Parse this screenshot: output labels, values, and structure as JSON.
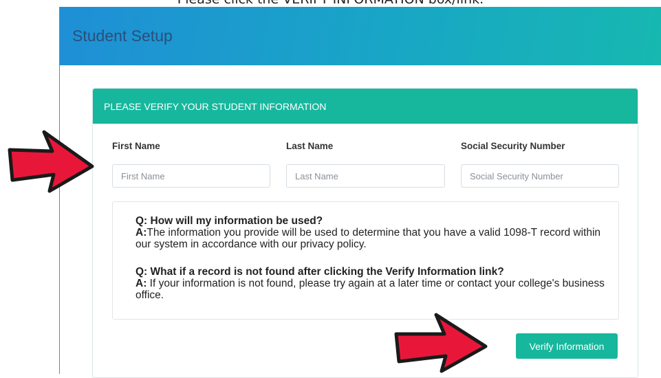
{
  "caption": "Please click the VERIFY INFORMATION box/link.",
  "header": {
    "title": "Student Setup"
  },
  "panel": {
    "title": "PLEASE VERIFY YOUR STUDENT INFORMATION",
    "fields": [
      {
        "label": "First Name",
        "placeholder": "First Name",
        "value": ""
      },
      {
        "label": "Last Name",
        "placeholder": "Last Name",
        "value": ""
      },
      {
        "label": "Social Security Number",
        "placeholder": "Social Security Number",
        "value": ""
      }
    ],
    "faq": [
      {
        "q": "Q: How will my information be used?",
        "a_prefix": "A:",
        "a": "The information you provide will be used to determine that you have a valid 1098-T record within our system in accordance with our privacy policy."
      },
      {
        "q": "Q: What if a record is not found after clicking the Verify Information link?",
        "a_prefix": "A:",
        "a": " If your information is not found, please try again at a later time or contact your college's business office."
      }
    ],
    "verify_button": "Verify Information"
  },
  "colors": {
    "header_gradient_start": "#1f8fd6",
    "header_gradient_end": "#17b8b0",
    "accent_teal": "#17b79e",
    "arrow_red": "#e8173a"
  },
  "annotations": [
    "red-arrow-icon",
    "red-arrow-icon"
  ]
}
